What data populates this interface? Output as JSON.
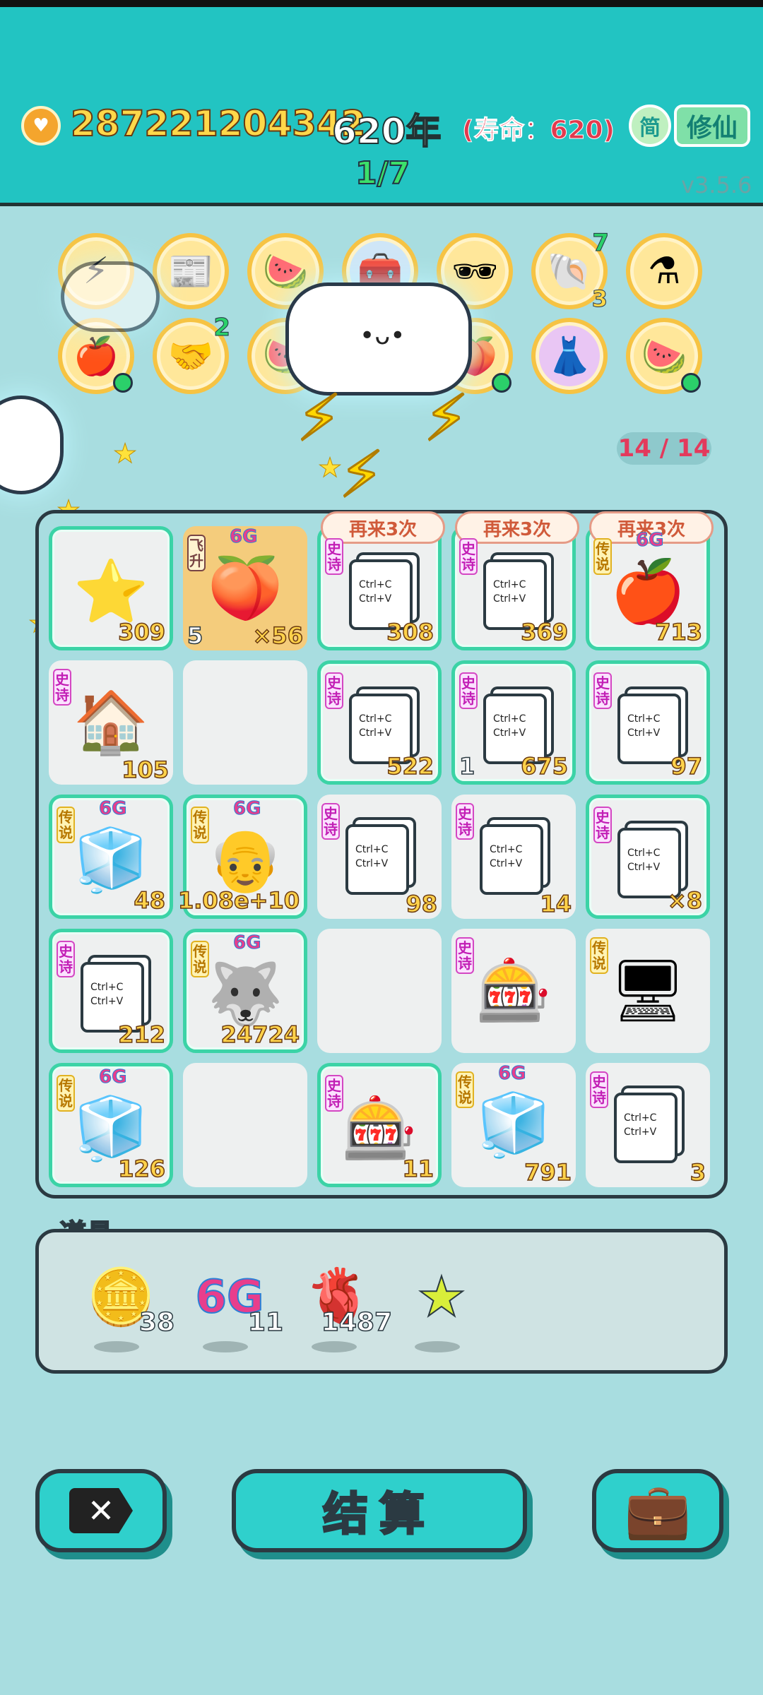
{
  "header": {
    "coins": "287221204342",
    "years": "620年",
    "lifespan": "(寿命：620)",
    "lang_label": "简",
    "xiuxian_label": "修仙",
    "stage": "1/7",
    "version": "v3.5.6"
  },
  "relics": {
    "badge_handshake": "2",
    "badge_shell_top": "7",
    "badge_shell_bottom": "3"
  },
  "board": {
    "counter": "14 / 14",
    "again_label": "再来3次",
    "cells": [
      {
        "tag": "",
        "g6": "",
        "left": "",
        "num": "309"
      },
      {
        "tag": "飞升",
        "g6": "6G",
        "left": "5",
        "num": "×56"
      },
      {
        "tag": "史诗",
        "g6": "",
        "left": "",
        "num": "308"
      },
      {
        "tag": "史诗",
        "g6": "",
        "left": "",
        "num": "369"
      },
      {
        "tag": "传说",
        "g6": "6G",
        "left": "",
        "num": "713"
      },
      {
        "tag": "史诗",
        "g6": "",
        "left": "",
        "num": "105"
      },
      {
        "tag": "",
        "g6": "",
        "left": "",
        "num": ""
      },
      {
        "tag": "史诗",
        "g6": "",
        "left": "",
        "num": "522"
      },
      {
        "tag": "史诗",
        "g6": "",
        "left": "1",
        "num": "675"
      },
      {
        "tag": "史诗",
        "g6": "",
        "left": "",
        "num": "97"
      },
      {
        "tag": "传说",
        "g6": "6G",
        "left": "",
        "num": "48"
      },
      {
        "tag": "传说",
        "g6": "6G",
        "left": "",
        "num": "1.08e+10"
      },
      {
        "tag": "史诗",
        "g6": "",
        "left": "",
        "num": "98"
      },
      {
        "tag": "史诗",
        "g6": "",
        "left": "",
        "num": "14"
      },
      {
        "tag": "史诗",
        "g6": "",
        "left": "",
        "num": "×8"
      },
      {
        "tag": "史诗",
        "g6": "",
        "left": "",
        "num": "212"
      },
      {
        "tag": "传说",
        "g6": "6G",
        "left": "",
        "num": "24724"
      },
      {
        "tag": "",
        "g6": "",
        "left": "",
        "num": ""
      },
      {
        "tag": "史诗",
        "g6": "",
        "left": "",
        "num": ""
      },
      {
        "tag": "传说",
        "g6": "",
        "left": "",
        "num": ""
      },
      {
        "tag": "传说",
        "g6": "6G",
        "left": "",
        "num": "126"
      },
      {
        "tag": "",
        "g6": "",
        "left": "",
        "num": ""
      },
      {
        "tag": "史诗",
        "g6": "",
        "left": "",
        "num": "11"
      },
      {
        "tag": "传说",
        "g6": "6G",
        "left": "",
        "num": "791"
      },
      {
        "tag": "史诗",
        "g6": "",
        "left": "",
        "num": "3"
      }
    ],
    "ctrl_text": "Ctrl+C\nCtrl+V"
  },
  "items": {
    "title": "道具",
    "coin_qty": "38",
    "g6_label": "6G",
    "g6_qty": "11",
    "liver_qty": "1487",
    "star_qty": ""
  },
  "buttons": {
    "settle_label": "结算",
    "close_label": "✕"
  },
  "icons": {
    "coin": "coin-icon",
    "bag": "briefcase-icon",
    "star": "star-icon"
  },
  "colors": {
    "header_bg": "#22c4c2",
    "page_bg": "#a8dde0",
    "cell_highlight": "#3bd3a6",
    "count_gold": "#ffd24a"
  }
}
